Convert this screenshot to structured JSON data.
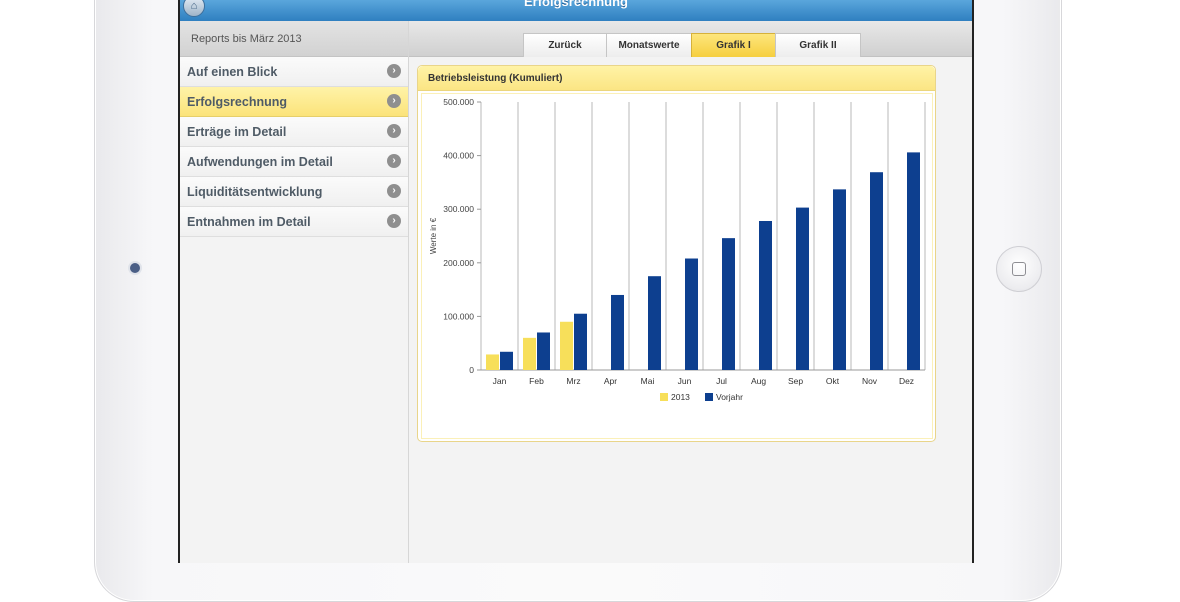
{
  "app": {
    "title": "Erfolgsrechnung"
  },
  "sidebar": {
    "header": "Reports bis März 2013",
    "items": [
      {
        "label": "Auf einen Blick",
        "active": false
      },
      {
        "label": "Erfolgsrechnung",
        "active": true
      },
      {
        "label": "Erträge im Detail",
        "active": false
      },
      {
        "label": "Aufwendungen im Detail",
        "active": false
      },
      {
        "label": "Liquiditätsentwicklung",
        "active": false
      },
      {
        "label": "Entnahmen im Detail",
        "active": false
      }
    ]
  },
  "tabs": [
    {
      "label": "Zurück",
      "active": false
    },
    {
      "label": "Monatswerte",
      "active": false
    },
    {
      "label": "Grafik I",
      "active": true
    },
    {
      "label": "Grafik II",
      "active": false
    }
  ],
  "colors": {
    "accent_yellow": "#fbe37a",
    "title_blue": "#3a8bcd",
    "series_2013": "#f7df5a",
    "series_vorjahr": "#0d3f8f"
  },
  "chart_data": {
    "type": "bar",
    "title": "Betriebsleistung (Kumuliert)",
    "ylabel": "Werte in €",
    "xlabel": "",
    "ylim": [
      0,
      500000
    ],
    "yticks": [
      "0",
      "100.000",
      "200.000",
      "300.000",
      "400.000",
      "500.000"
    ],
    "yticks_values": [
      0,
      100000,
      200000,
      300000,
      400000,
      500000
    ],
    "categories": [
      "Jan",
      "Feb",
      "Mrz",
      "Apr",
      "Mai",
      "Jun",
      "Jul",
      "Aug",
      "Sep",
      "Okt",
      "Nov",
      "Dez"
    ],
    "series": [
      {
        "name": "2013",
        "values": [
          29000,
          60000,
          90000,
          0,
          0,
          0,
          0,
          0,
          0,
          0,
          0,
          0
        ]
      },
      {
        "name": "Vorjahr",
        "values": [
          34000,
          70000,
          105000,
          140000,
          175000,
          208000,
          246000,
          278000,
          303000,
          337000,
          369000,
          406000
        ]
      }
    ],
    "legend": "bottom-center",
    "grid": true
  }
}
